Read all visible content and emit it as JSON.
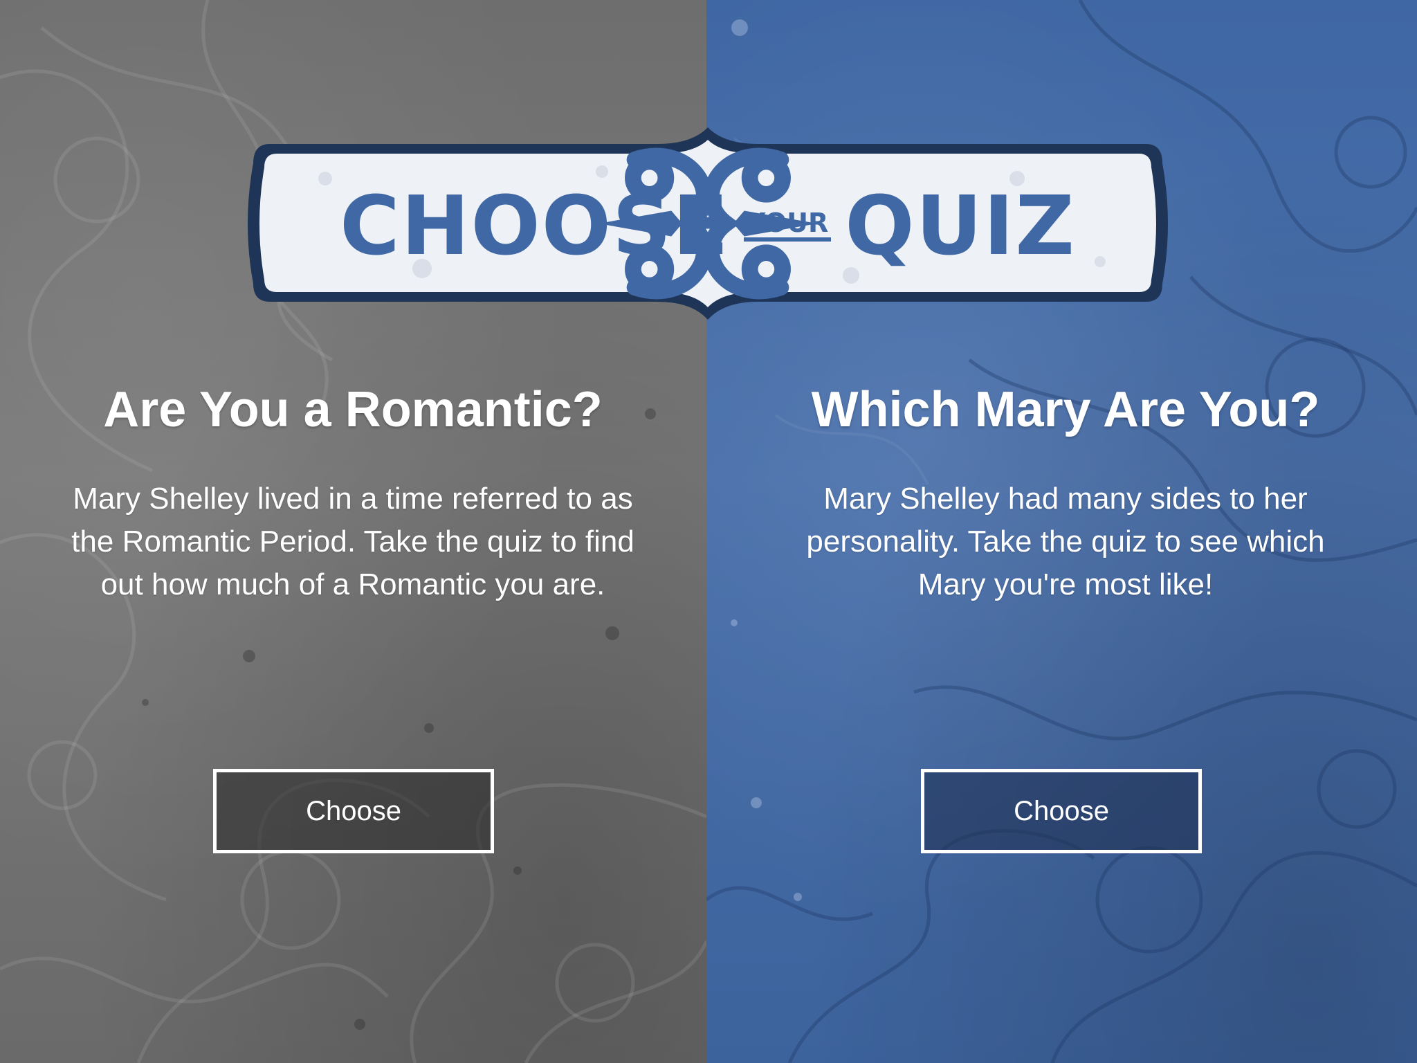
{
  "banner": {
    "word_left": "CHOOSE",
    "word_middle": "YOUR",
    "word_right": "QUIZ",
    "text_color": "#3f68a4",
    "border_color": "#1e3558"
  },
  "quizzes": [
    {
      "title": "Are You a Romantic?",
      "description": "Mary Shelley lived in a time referred to as the Romantic Period. Take the quiz to find out how much of a Romantic you are.",
      "button_label": "Choose",
      "panel_color": "#737373"
    },
    {
      "title": "Which Mary Are You?",
      "description": "Mary Shelley had many sides to her personality. Take the quiz to see which Mary you're most like!",
      "button_label": "Choose",
      "panel_color": "#446ba6"
    }
  ]
}
